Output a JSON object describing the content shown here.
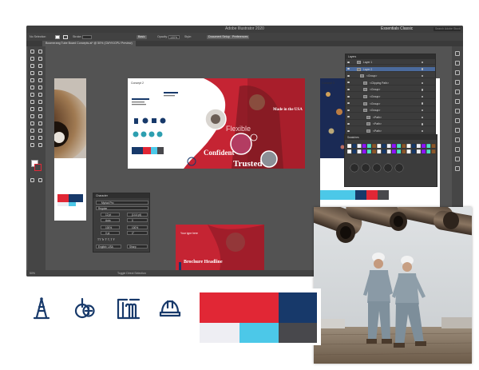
{
  "window": {
    "title": "Adobe Illustrator 2020",
    "workspace": "Essentials Classic",
    "search_placeholder": "Search Adobe Stock",
    "doc_tab": "Boomerang Tube Board Concepts.ai* @ 50% (CMYK/GPU Preview)",
    "zoom": "50%",
    "status_tool": "Toggle Direct Selection"
  },
  "control_bar": {
    "no_selection": "No Selection",
    "stroke": "Stroke:",
    "stroke_weight": "",
    "style_label": "Basic",
    "opacity": "Opacity:",
    "opacity_value": "100%",
    "style": "Style:",
    "doc_setup": "Document Setup",
    "preferences": "Preferences"
  },
  "artboards": {
    "concept2_label": "Concept 2",
    "concept3_label": "Concept 3",
    "made_in_usa": "Made in the USA",
    "flexible": "Flexible",
    "confident": "Confident",
    "trusted": "Trusted",
    "headline_small": "Your type here",
    "brochure_headline": "Brochure Headline"
  },
  "layers_panel": {
    "title": "Layers",
    "rows": [
      "Layer 1",
      "Layer 2",
      "<Group>",
      "<Clipping Path>",
      "<Group>",
      "<Group>",
      "<Group>",
      "<Group>",
      "<Path>",
      "<Path>",
      "<Path>",
      "<Path>"
    ]
  },
  "swatches_panel": {
    "title": "Swatches"
  },
  "character_panel": {
    "title": "Character",
    "search": "Myriad Pro",
    "style": "Regular",
    "size": "12 pt",
    "leading": "(14.4 pt)",
    "kerning": "Auto",
    "tracking": "0",
    "vscale": "100%",
    "hscale": "100%",
    "baseline": "0 pt",
    "rotation": "0°",
    "language": "English: USA",
    "aa": "Sharp"
  },
  "colors": {
    "red": "#E12735",
    "navy": "#17396A",
    "light_gray": "#EEEEF3",
    "cyan": "#4CC8E8",
    "dark_gray": "#48484C",
    "ui_gray": "#535353"
  },
  "icons": [
    "oil-derrick-icon",
    "drill-gear-icon",
    "pipe-rack-icon",
    "hard-hat-icon"
  ]
}
